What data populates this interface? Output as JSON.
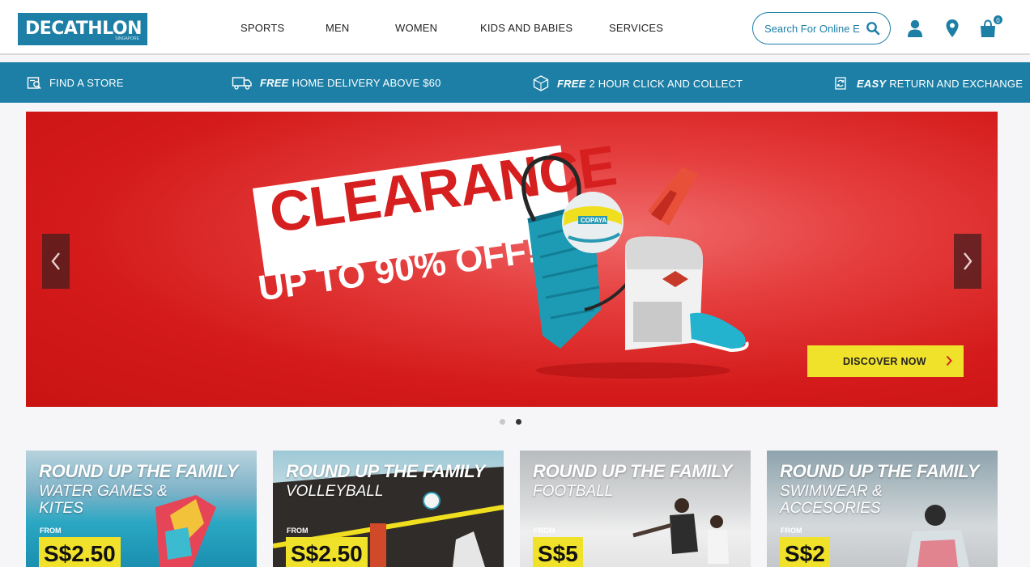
{
  "brand": {
    "logo_text": "DECATHLON",
    "logo_sub": "SINGAPORE",
    "color": "#1d7fa6"
  },
  "nav": [
    {
      "label": "SPORTS"
    },
    {
      "label": "MEN"
    },
    {
      "label": "WOMEN"
    },
    {
      "label": "KIDS AND BABIES"
    },
    {
      "label": "SERVICES"
    }
  ],
  "search": {
    "placeholder": "Search For Online Exclusives"
  },
  "header_icons": {
    "account": "user-icon",
    "store": "map-pin-icon",
    "cart": "shopping-bag-icon",
    "cart_count": "0"
  },
  "services": [
    {
      "icon": "store-locator-icon",
      "bold": "",
      "text": "FIND A STORE"
    },
    {
      "icon": "delivery-truck-icon",
      "bold": "FREE",
      "text": "HOME DELIVERY ABOVE $60"
    },
    {
      "icon": "click-collect-box-icon",
      "bold": "FREE",
      "text": "2 HOUR CLICK AND COLLECT"
    },
    {
      "icon": "return-exchange-icon",
      "bold": "EASY",
      "text": "RETURN AND EXCHANGE"
    }
  ],
  "hero": {
    "title": "CLEARANCE",
    "subtitle": "UP TO 90% OFF!",
    "ball_brand": "COPAYA",
    "cta": "DISCOVER NOW",
    "background_color": "#d41a1a",
    "cta_color": "#f0e12a",
    "slides": 2,
    "active_slide": 2
  },
  "cards": [
    {
      "title": "ROUND UP THE FAMILY",
      "subtitle": "WATER GAMES & KITES",
      "from": "FROM",
      "price": "S$2.50"
    },
    {
      "title": "ROUND UP THE FAMILY",
      "subtitle": "VOLLEYBALL",
      "from": "FROM",
      "price": "S$2.50"
    },
    {
      "title": "ROUND UP THE FAMILY",
      "subtitle": "FOOTBALL",
      "from": "FROM",
      "price": "S$5"
    },
    {
      "title": "ROUND UP THE FAMILY",
      "subtitle": "SWIMWEAR & ACCESORIES",
      "from": "FROM",
      "price": "S$2"
    }
  ]
}
